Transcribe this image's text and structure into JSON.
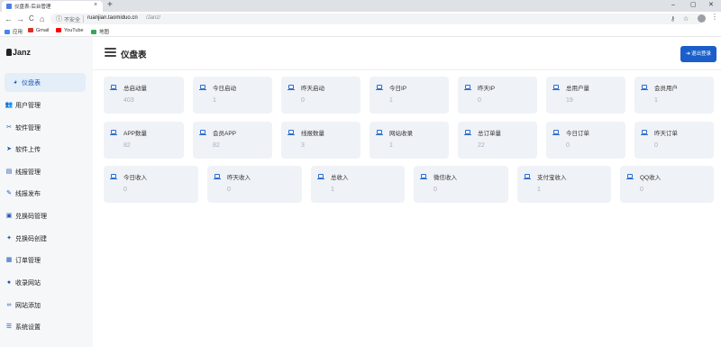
{
  "browser": {
    "tab_title": "仪盘表-后台管理",
    "tab_close": "×",
    "new_tab": "+",
    "win_min": "–",
    "win_max": "▢",
    "win_close": "✕",
    "back": "←",
    "forward": "→",
    "reload": "C",
    "home": "⌂",
    "info_icon": "ⓘ",
    "insecure_label": "不安全",
    "url_host": "ruanjian.taomiduo.cn",
    "url_path": "/Janz/",
    "key_icon": "⚷",
    "star_icon": "☆",
    "menu_icon": "⋮",
    "bookmarks": [
      {
        "label": "应用",
        "icon": "apps-icon",
        "color": "#4285f4"
      },
      {
        "label": "Gmail",
        "icon": "gmail-icon",
        "color": "#d93025"
      },
      {
        "label": "YouTube",
        "icon": "youtube-icon",
        "color": "#ff0000"
      },
      {
        "label": "地图",
        "icon": "maps-icon",
        "color": "#34a853"
      }
    ]
  },
  "app": {
    "logo_text": "Janz",
    "page_title": "仪盘表",
    "logout_label": "退出登录",
    "logout_icon": "➜",
    "accent_color": "#1a5fc9"
  },
  "sidebar": {
    "items": [
      {
        "label": "仪盘表",
        "icon": "dashboard-icon",
        "glyph": "◕",
        "active": true
      },
      {
        "label": "用户管理",
        "icon": "users-icon",
        "glyph": "👥",
        "active": false
      },
      {
        "label": "软件管理",
        "icon": "tools-icon",
        "glyph": "✂",
        "active": false
      },
      {
        "label": "软件上传",
        "icon": "send-icon",
        "glyph": "➤",
        "active": false
      },
      {
        "label": "线报管理",
        "icon": "news-icon",
        "glyph": "▤",
        "active": false
      },
      {
        "label": "线报发布",
        "icon": "edit-icon",
        "glyph": "✎",
        "active": false
      },
      {
        "label": "兑换码管理",
        "icon": "gift-icon",
        "glyph": "▣",
        "active": false
      },
      {
        "label": "兑换码创建",
        "icon": "wand-icon",
        "glyph": "✦",
        "active": false
      },
      {
        "label": "订单管理",
        "icon": "receipt-icon",
        "glyph": "▦",
        "active": false
      },
      {
        "label": "收录网站",
        "icon": "globe-icon",
        "glyph": "●",
        "active": false
      },
      {
        "label": "网站添加",
        "icon": "link-icon",
        "glyph": "∞",
        "active": false
      },
      {
        "label": "系统设置",
        "icon": "settings-icon",
        "glyph": "☰",
        "active": false
      }
    ]
  },
  "stats": {
    "row1": [
      {
        "label": "总启动量",
        "value": "403"
      },
      {
        "label": "今日启动",
        "value": "1"
      },
      {
        "label": "昨天启动",
        "value": "0"
      },
      {
        "label": "今日IP",
        "value": "1"
      },
      {
        "label": "昨天IP",
        "value": "0"
      },
      {
        "label": "总用户量",
        "value": "19"
      },
      {
        "label": "会员用户",
        "value": "1"
      }
    ],
    "row2": [
      {
        "label": "APP数量",
        "value": "82"
      },
      {
        "label": "会员APP",
        "value": "82"
      },
      {
        "label": "线报数量",
        "value": "3"
      },
      {
        "label": "网站收录",
        "value": "1"
      },
      {
        "label": "总订单量",
        "value": "22"
      },
      {
        "label": "今日订单",
        "value": "0"
      },
      {
        "label": "昨天订单",
        "value": "0"
      }
    ],
    "row3": [
      {
        "label": "今日收入",
        "value": "0"
      },
      {
        "label": "昨天收入",
        "value": "0"
      },
      {
        "label": "总收入",
        "value": "1"
      },
      {
        "label": "微信收入",
        "value": "0"
      },
      {
        "label": "支付宝收入",
        "value": "1"
      },
      {
        "label": "QQ收入",
        "value": "0"
      }
    ]
  }
}
